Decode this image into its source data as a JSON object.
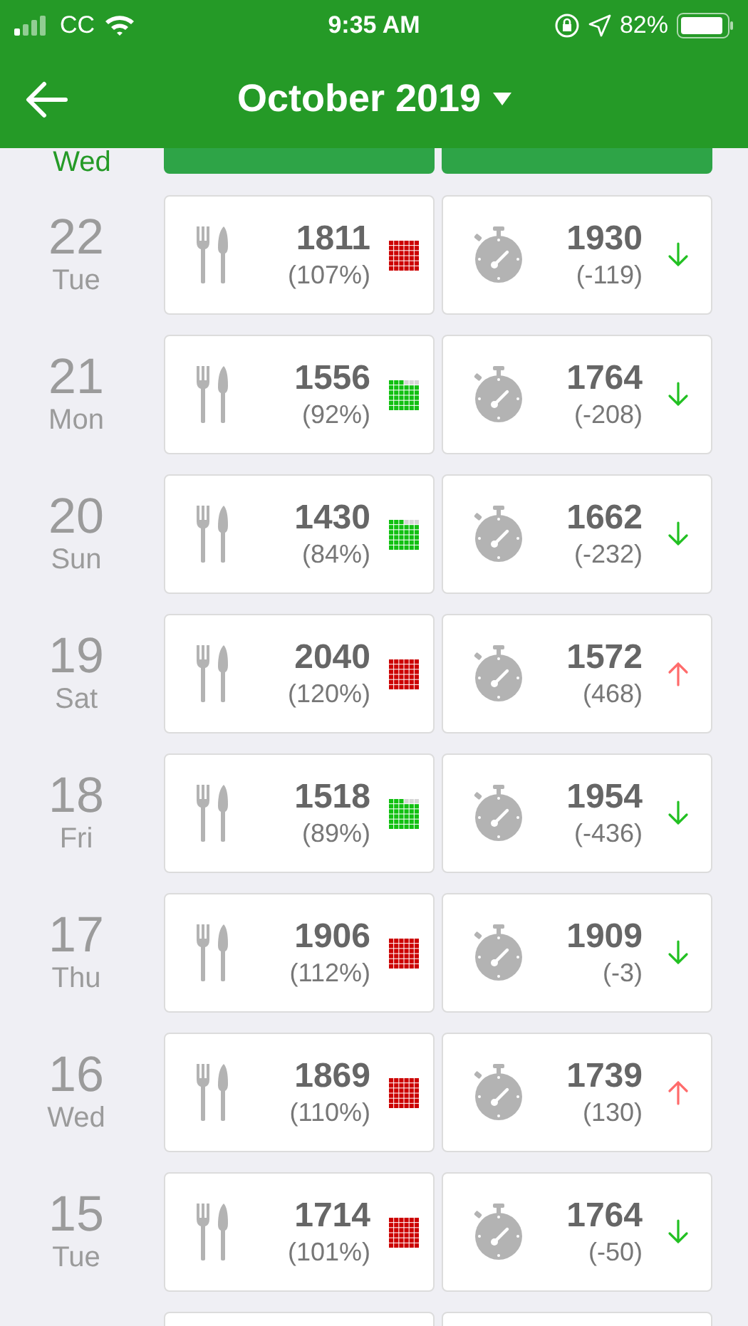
{
  "status_bar": {
    "carrier": "CC",
    "time": "9:35 AM",
    "battery": "82%"
  },
  "header": {
    "title": "October 2019"
  },
  "partial_row": {
    "weekday": "Wed"
  },
  "days": [
    {
      "day": "22",
      "weekday": "Tue",
      "eaten": "1811",
      "eaten_percent": "(107%)",
      "meter": {
        "kind": "full",
        "color": "#cc0000"
      },
      "burned": "1930",
      "difference": "(-119)",
      "trend": {
        "kind": "down",
        "color": "#22c022"
      }
    },
    {
      "day": "21",
      "weekday": "Mon",
      "eaten": "1556",
      "eaten_percent": "(92%)",
      "meter": {
        "kind": "partial",
        "color": "#11c011"
      },
      "burned": "1764",
      "difference": "(-208)",
      "trend": {
        "kind": "down",
        "color": "#22c022"
      }
    },
    {
      "day": "20",
      "weekday": "Sun",
      "eaten": "1430",
      "eaten_percent": "(84%)",
      "meter": {
        "kind": "partial",
        "color": "#11c011"
      },
      "burned": "1662",
      "difference": "(-232)",
      "trend": {
        "kind": "down",
        "color": "#22c022"
      }
    },
    {
      "day": "19",
      "weekday": "Sat",
      "eaten": "2040",
      "eaten_percent": "(120%)",
      "meter": {
        "kind": "full",
        "color": "#cc0000"
      },
      "burned": "1572",
      "difference": "(468)",
      "trend": {
        "kind": "up",
        "color": "#ff6b6b"
      }
    },
    {
      "day": "18",
      "weekday": "Fri",
      "eaten": "1518",
      "eaten_percent": "(89%)",
      "meter": {
        "kind": "partial",
        "color": "#11c011"
      },
      "burned": "1954",
      "difference": "(-436)",
      "trend": {
        "kind": "down",
        "color": "#22c022"
      }
    },
    {
      "day": "17",
      "weekday": "Thu",
      "eaten": "1906",
      "eaten_percent": "(112%)",
      "meter": {
        "kind": "full",
        "color": "#cc0000"
      },
      "burned": "1909",
      "difference": "(-3)",
      "trend": {
        "kind": "down",
        "color": "#22c022"
      }
    },
    {
      "day": "16",
      "weekday": "Wed",
      "eaten": "1869",
      "eaten_percent": "(110%)",
      "meter": {
        "kind": "full",
        "color": "#cc0000"
      },
      "burned": "1739",
      "difference": "(130)",
      "trend": {
        "kind": "up",
        "color": "#ff6b6b"
      }
    },
    {
      "day": "15",
      "weekday": "Tue",
      "eaten": "1714",
      "eaten_percent": "(101%)",
      "meter": {
        "kind": "full",
        "color": "#cc0000"
      },
      "burned": "1764",
      "difference": "(-50)",
      "trend": {
        "kind": "down",
        "color": "#22c022"
      }
    }
  ]
}
